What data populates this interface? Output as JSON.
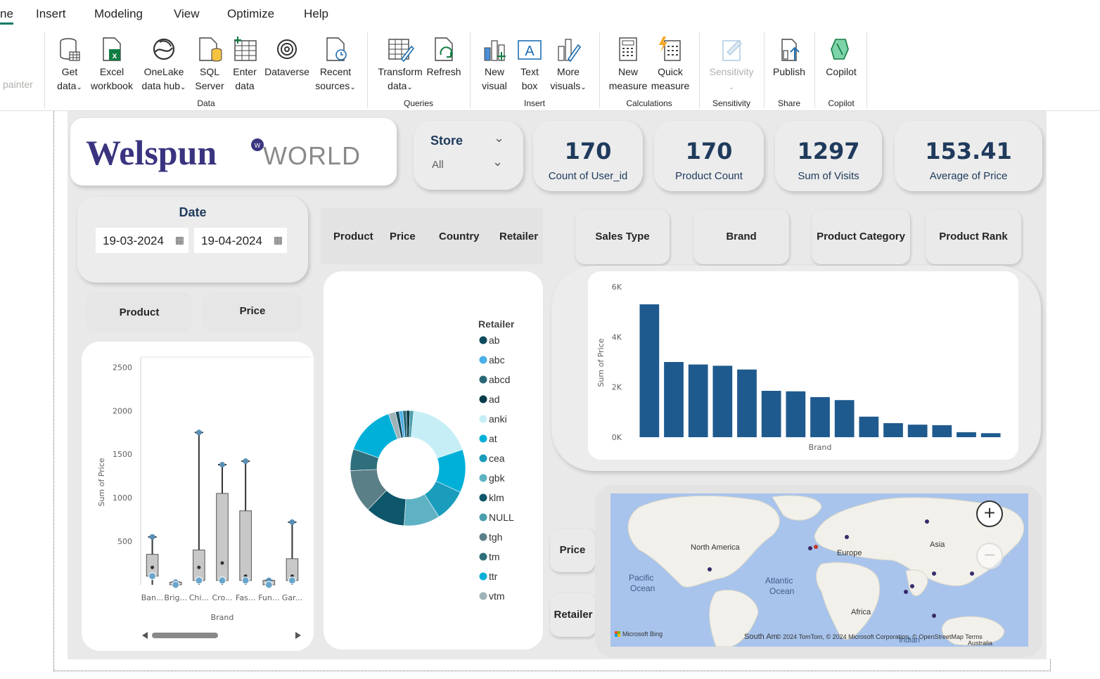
{
  "menu": {
    "tabs": [
      {
        "label": "ne"
      },
      {
        "label": "Insert"
      },
      {
        "label": "Modeling"
      },
      {
        "label": "View"
      },
      {
        "label": "Optimize"
      },
      {
        "label": "Help"
      }
    ]
  },
  "ribbon": {
    "format_painter": "painter",
    "data_group": "Data",
    "queries_group": "Queries",
    "insert_group": "Insert",
    "calculations_group": "Calculations",
    "sensitivity_group": "Sensitivity",
    "share_group": "Share",
    "copilot_group": "Copilot",
    "get_data": [
      "Get",
      "data"
    ],
    "excel": [
      "Excel",
      "workbook"
    ],
    "onelake": [
      "OneLake",
      "data hub"
    ],
    "sql": [
      "SQL",
      "Server"
    ],
    "enter_data": [
      "Enter",
      "data"
    ],
    "dataverse": "Dataverse",
    "recent": [
      "Recent",
      "sources"
    ],
    "transform": [
      "Transform",
      "data"
    ],
    "refresh": "Refresh",
    "new_visual": [
      "New",
      "visual"
    ],
    "text_box": [
      "Text",
      "box"
    ],
    "more_visuals": [
      "More",
      "visuals"
    ],
    "new_measure": [
      "New",
      "measure"
    ],
    "quick_measure": [
      "Quick",
      "measure"
    ],
    "sensitivity": "Sensitivity",
    "publish": "Publish",
    "copilot": "Copilot"
  },
  "report": {
    "logo_text_1": "Welspun",
    "logo_text_2": "WORLD",
    "store_slicer": {
      "title": "Store",
      "value": "All"
    },
    "kpis": [
      {
        "value": "170",
        "label": "Count of User_id"
      },
      {
        "value": "170",
        "label": "Product Count"
      },
      {
        "value": "1297",
        "label": "Sum of Visits"
      },
      {
        "value": "153.41",
        "label": "Average of Price"
      }
    ],
    "date_slicer": {
      "title": "Date",
      "start": "19-03-2024",
      "end": "19-04-2024"
    },
    "field_buttons_top": [
      "Product",
      "Price",
      "Country",
      "Retailer"
    ],
    "nav_buttons": [
      "Sales Type",
      "Brand",
      "Product Category",
      "Product Rank"
    ],
    "left_buttons": [
      "Product",
      "Price"
    ],
    "map_buttons": [
      "Price",
      "Retailer"
    ],
    "map": {
      "labels": [
        "North America",
        "Europe",
        "Asia",
        "Pacific",
        "Ocean",
        "Atlantic",
        "Ocean",
        "Africa",
        "South Am",
        "Indian",
        "Australia"
      ],
      "attribution": "© 2024 TomTom, © 2024 Microsoft Corporation, © OpenStreetMap  Terms",
      "bing": "Microsoft Bing",
      "zoom_in": "+",
      "zoom_out": "−"
    }
  },
  "colors": {
    "accent": "#117865",
    "bar": "#1f5a8e",
    "kpi_text": "#1f3a5c"
  },
  "chart_data": [
    {
      "type": "bar",
      "title": "",
      "xlabel": "Brand",
      "ylabel": "Sum of Price",
      "yticks": [
        "0K",
        "2K",
        "4K",
        "6K"
      ],
      "ylim": [
        0,
        6000
      ],
      "values": [
        5300,
        3000,
        2900,
        2850,
        2700,
        1850,
        1830,
        1600,
        1480,
        820,
        560,
        500,
        480,
        200,
        160
      ],
      "grid": false
    },
    {
      "type": "pie",
      "legend_title": "Retailer",
      "legend_position": "right",
      "slices": [
        {
          "label": "anki",
          "value": 18,
          "color": "#c6eef6"
        },
        {
          "label": "at",
          "value": 12,
          "color": "#00b0d8"
        },
        {
          "label": "cea",
          "value": 9,
          "color": "#1a9cbc"
        },
        {
          "label": "gbk",
          "value": 10,
          "color": "#5fb2c3"
        },
        {
          "label": "klm",
          "value": 11,
          "color": "#0e5669"
        },
        {
          "label": "tgh",
          "value": 12,
          "color": "#5b7f86"
        },
        {
          "label": "tm",
          "value": 6,
          "color": "#2e6f7b"
        },
        {
          "label": "ttr",
          "value": 14,
          "color": "#00b0d8"
        },
        {
          "label": "vtm",
          "value": 2,
          "color": "#9fb4b9"
        },
        {
          "label": "ab",
          "value": 1,
          "color": "#0e4b5c"
        },
        {
          "label": "abc",
          "value": 1,
          "color": "#4ab0e8"
        },
        {
          "label": "abcd",
          "value": 1,
          "color": "#2a6775"
        },
        {
          "label": "ad",
          "value": 1,
          "color": "#083c4a"
        },
        {
          "label": "NULL",
          "value": 1,
          "color": "#4aa0ad"
        }
      ],
      "legend": [
        {
          "label": "ab",
          "color": "#0e4b5c"
        },
        {
          "label": "abc",
          "color": "#4ab0e8"
        },
        {
          "label": "abcd",
          "color": "#2a6775"
        },
        {
          "label": "ad",
          "color": "#083c4a"
        },
        {
          "label": "anki",
          "color": "#c6eef6"
        },
        {
          "label": "at",
          "color": "#00b0d8"
        },
        {
          "label": "cea",
          "color": "#1a9cbc"
        },
        {
          "label": "gbk",
          "color": "#5fb2c3"
        },
        {
          "label": "klm",
          "color": "#0e5669"
        },
        {
          "label": "NULL",
          "color": "#4aa0ad"
        },
        {
          "label": "tgh",
          "color": "#5b7f86"
        },
        {
          "label": "tm",
          "color": "#2e6f7b"
        },
        {
          "label": "ttr",
          "color": "#00b0d8"
        },
        {
          "label": "vtm",
          "color": "#9fb4b9"
        }
      ]
    },
    {
      "type": "box",
      "xlabel": "Brand",
      "ylabel": "Sum of Price",
      "yticks": [
        "500",
        "1000",
        "1500",
        "2000",
        "2500"
      ],
      "ylim": [
        0,
        2600
      ],
      "categories": [
        "Ban...",
        "Brig...",
        "Chi...",
        "Cro...",
        "Fas...",
        "Fun...",
        "Gar..."
      ],
      "boxes": [
        {
          "min": 0,
          "q1": 100,
          "median": 200,
          "q3": 350,
          "max": 550
        },
        {
          "min": 0,
          "q1": 0,
          "median": 0,
          "q3": 30,
          "max": 30
        },
        {
          "min": 0,
          "q1": 50,
          "median": 200,
          "q3": 400,
          "max": 1750
        },
        {
          "min": 0,
          "q1": 50,
          "median": 250,
          "q3": 1050,
          "max": 1380
        },
        {
          "min": 0,
          "q1": 50,
          "median": 100,
          "q3": 850,
          "max": 1420
        },
        {
          "min": 0,
          "q1": 0,
          "median": 0,
          "q3": 50,
          "max": 50
        },
        {
          "min": 0,
          "q1": 50,
          "median": 100,
          "q3": 300,
          "max": 720
        }
      ]
    }
  ]
}
